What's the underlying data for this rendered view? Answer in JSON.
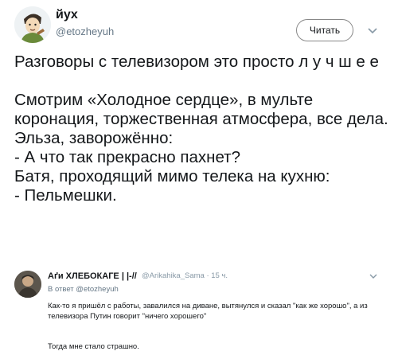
{
  "tweet": {
    "author_name": "йух",
    "author_handle": "@etozheyuh",
    "follow_label": "Читать",
    "avatar_icon": "avatar-illustration-icon",
    "text": "Разговоры с телевизором это просто  л у ч ш е е\n\nСмотрим «Холодное сердце», в мульте коронация, торжественная атмосфера, все дела.\nЭльза, заворожённо:\n- А что так прекрасно пахнет?\nБатя, проходящий мимо телека на кухню:\n- Пельмешки."
  },
  "reply": {
    "author_name": "Аґи ХЛЕБОКАГЕ | |-//",
    "meta": "@Arikahika_Sama · 15 ч.",
    "in_reply_to": "В ответ @etozheyuh",
    "body": "Как-то я пришёл с работы, завалился на диване, вытянулся и сказал \"как же хорошо\",  а из телевизора Путин говорит \"ничего хорошего\"",
    "body2": "Тогда мне стало страшно."
  },
  "colors": {
    "text": "#14171a",
    "secondary": "#657786",
    "border": "#888888",
    "reply_logo": "#e0245e"
  }
}
